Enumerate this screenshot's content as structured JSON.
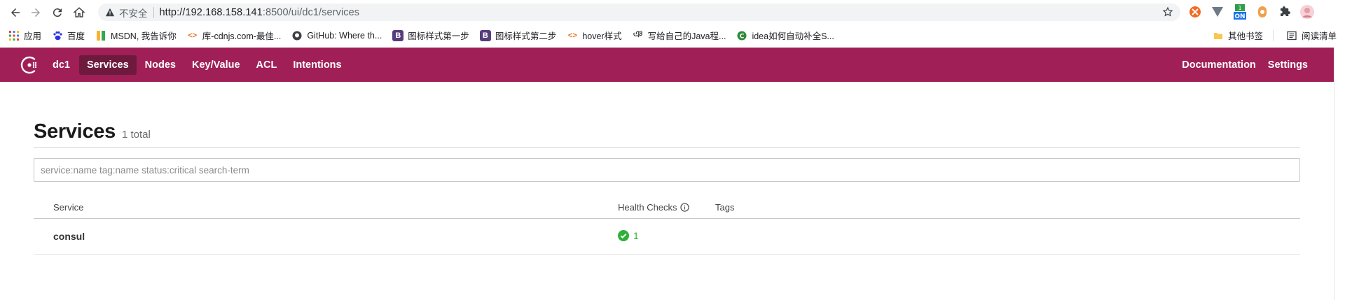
{
  "browser": {
    "security_label": "不安全",
    "url_host": "http://192.168.158.141",
    "url_path": ":8500/ui/dc1/services",
    "bookmarks": [
      {
        "icon": "apps-grid-icon",
        "label": "应用"
      },
      {
        "icon": "baidu-paw-icon",
        "label": "百度"
      },
      {
        "icon": "msdn-icon",
        "label": "MSDN, 我告诉你"
      },
      {
        "icon": "code-brackets-icon",
        "label": "库-cdnjs.com-最佳..."
      },
      {
        "icon": "github-icon",
        "label": "GitHub: Where th..."
      },
      {
        "icon": "bootstrap-icon",
        "label": "图标样式第一步"
      },
      {
        "icon": "bootstrap-icon",
        "label": "图标样式第二步"
      },
      {
        "icon": "code-brackets-icon",
        "label": "hover样式"
      },
      {
        "icon": "script-icon",
        "label": "写给自己的Java程..."
      },
      {
        "icon": "idea-icon",
        "label": "idea如何自动补全S..."
      }
    ],
    "bookmarks_right": [
      {
        "icon": "folder-icon",
        "label": "其他书签"
      },
      {
        "icon": "reading-list-icon",
        "label": "阅读清单"
      }
    ]
  },
  "header": {
    "datacenter": "dc1",
    "nav": [
      "Services",
      "Nodes",
      "Key/Value",
      "ACL",
      "Intentions"
    ],
    "active": "Services",
    "right_nav": [
      "Documentation",
      "Settings"
    ],
    "brand_color": "#a01f56"
  },
  "page": {
    "title": "Services",
    "count": "1 total",
    "search_placeholder": "service:name tag:name status:critical search-term"
  },
  "table": {
    "headers": {
      "service": "Service",
      "health": "Health Checks",
      "tags": "Tags"
    },
    "rows": [
      {
        "name": "consul",
        "passing": "1",
        "tags": ""
      }
    ]
  },
  "colors": {
    "passing": "#2eb039"
  }
}
